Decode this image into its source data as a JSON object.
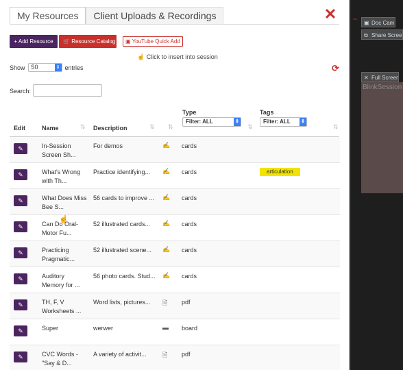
{
  "background": {
    "doc_cam": "Doc Cam",
    "share_screen": "Share Screen",
    "full_screen": "Full Screen",
    "session_text": "BlinkSession"
  },
  "tabs": [
    {
      "label": "My Resources",
      "active": true
    },
    {
      "label": "Client Uploads & Recordings",
      "active": false
    }
  ],
  "toolbar": {
    "add_label": "+ Add Resource",
    "catalog_label": "Resource Catalog",
    "youtube_label": "YouTube Quick Add",
    "hint": "Click to insert into session"
  },
  "table_controls": {
    "show_label": "Show",
    "entries_value": "50",
    "entries_label": "entries",
    "search_label": "Search:",
    "search_value": ""
  },
  "columns": {
    "edit": "Edit",
    "name": "Name",
    "description": "Description",
    "type": "Type",
    "type_filter": "Filter: ALL",
    "tags": "Tags",
    "tags_filter": "Filter: ALL"
  },
  "rows": [
    {
      "name": "In-Session Screen Sh...",
      "description": "For demos",
      "icon": "pencil-icon",
      "type": "cards",
      "tag": ""
    },
    {
      "name": "What's Wrong with Th...",
      "description": "Practice identifying...",
      "icon": "pencil-icon",
      "type": "cards",
      "tag": "articulation"
    },
    {
      "name": "What Does Miss Bee S...",
      "description": "56 cards to improve ...",
      "icon": "pencil-icon",
      "type": "cards",
      "tag": ""
    },
    {
      "name": "Can Do Oral-Motor Fu...",
      "description": "52 illustrated cards...",
      "icon": "pencil-icon",
      "type": "cards",
      "tag": ""
    },
    {
      "name": "Practicing Pragmatic...",
      "description": "52 illustrated scene...",
      "icon": "pencil-icon",
      "type": "cards",
      "tag": ""
    },
    {
      "name": "Auditory Memory for ...",
      "description": "56 photo cards. Stud...",
      "icon": "pencil-icon",
      "type": "cards",
      "tag": ""
    },
    {
      "name": "TH, F, V Worksheets ...",
      "description": "Word lists, pictures...",
      "icon": "pdf-icon",
      "type": "pdf",
      "tag": ""
    },
    {
      "name": "Super",
      "description": "werwer",
      "icon": "board-icon",
      "type": "board",
      "tag": ""
    },
    {
      "name": "CVC Words - \"Say & D...",
      "description": "A variety of activit...",
      "icon": "pdf-icon",
      "type": "pdf",
      "tag": ""
    }
  ]
}
